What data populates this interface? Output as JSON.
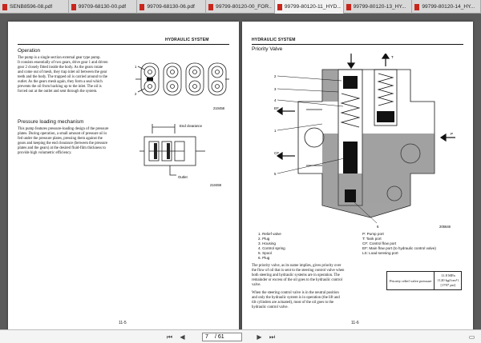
{
  "tabs": [
    {
      "label": "SENB8596-08.pdf",
      "active": false
    },
    {
      "label": "99709-68130-00.pdf",
      "active": false
    },
    {
      "label": "99709-68130-06.pdf",
      "active": false
    },
    {
      "label": "99799-80120-00_FOR...",
      "active": false
    },
    {
      "label": "99799-80120-11_HYD...",
      "active": true
    },
    {
      "label": "99799-80120-13_HY...",
      "active": false
    },
    {
      "label": "99799-80120-14_HY...",
      "active": false
    }
  ],
  "left_page": {
    "header": "HYDRAULIC SYSTEM",
    "operation": {
      "title": "Operation",
      "lines": [
        "The pump is a single section external gear type pump.",
        "It consists essentially of two gears, drive gear 1 and driven",
        "gear 2 closely fitted inside the body.  As the gears rotate",
        "and come out of mesh, they trap inlet oil between the gear",
        "teeth and the body.  The trapped oil is carried around to the",
        "outlet.  As the gears mesh again, they form a seal which",
        "prevents the oil from backing up to the inlet.  The oil is",
        "forced out at the outlet and sent through the system."
      ],
      "figure_number": "210458",
      "figure_labels": [
        "1",
        "2"
      ]
    },
    "pressure": {
      "title": "Pressure loading mechanism",
      "lines": [
        "This pump features pressure-loading design of the pressure",
        "plates. During operation, a small amount of pressure oil is",
        "fed under the pressure plates, pressing them against the",
        "gears and keeping the end clearance (between the pressure",
        "plates and the gears) at the desired fluid-film thickness to",
        "provide high volumetric efficiency."
      ],
      "figure_number": "210459",
      "end_clearance": "End clearance",
      "outlet": "Outlet"
    },
    "page_number": "11-5"
  },
  "right_page": {
    "header": "HYDRAULIC SYSTEM",
    "title": "Priority Valve",
    "figure_number": "205646",
    "callouts": {
      "ls": "LS",
      "t": "T",
      "ef": "EF",
      "cf": "CF",
      "p": "P",
      "n1": "1",
      "n2": "2",
      "n3": "3",
      "n4": "4",
      "n5": "5",
      "n6": "6"
    },
    "legend_left": [
      "1.   Relief valve",
      "2.   Plug",
      "3.   Housing",
      "4.   Control spring",
      "5.   Spool",
      "6.   Plug"
    ],
    "legend_right": [
      "P:  Pump port",
      "T:  Tank port",
      "CF:  Control flow port",
      "EF:  Main flow port (to hydraulic control valve)",
      "LS:  Load sensing port"
    ],
    "body_lines": [
      "The priority valve, as its name implies, gives priority over",
      "the flow of oil that is sent to the steering control valve when",
      "both steering and hydraulic systems are in operation.  The",
      "remainder or excess of the oil goes to the hydraulic control",
      "valve."
    ],
    "body_lines2": [
      "When the steering control valve is in the neutral position",
      "and only the hydraulic system is in operation (the lift and",
      "tilt cylinders are actuated), most of the oil goes to the",
      "hydraulic control valve."
    ],
    "spec_label": "Priority relief valve pressure",
    "spec_value": [
      "11.8 MPa",
      "{120 kgf/cm²}",
      "[1707 psi]"
    ],
    "page_number": "11-6"
  },
  "toolbar": {
    "current_page": "7",
    "total_pages": "/ 61"
  }
}
